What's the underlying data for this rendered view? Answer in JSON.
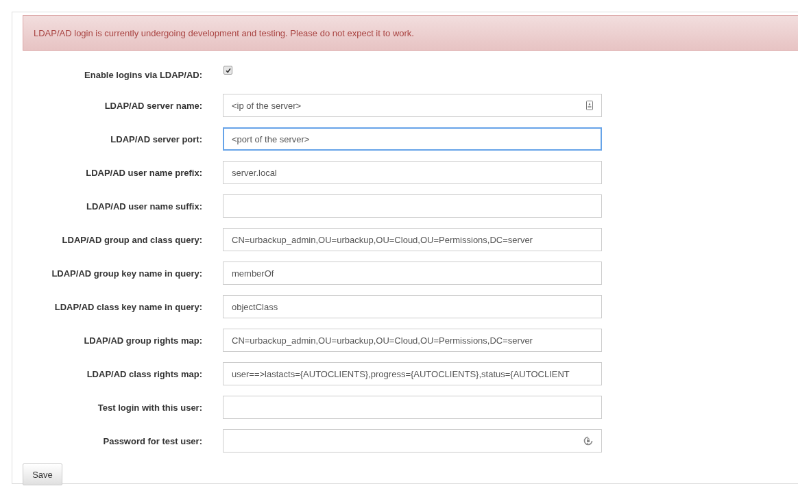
{
  "alert": {
    "text": "LDAP/AD login is currently undergoing development and testing. Please do not expect it to work."
  },
  "fields": [
    {
      "kind": "checkbox",
      "label": "Enable logins via LDAP/AD:",
      "checked": true
    },
    {
      "kind": "autofill",
      "label": "LDAP/AD server name:",
      "value": "<ip of the server>",
      "focused": false
    },
    {
      "kind": "text",
      "label": "LDAP/AD server port:",
      "value": "<port of the server>",
      "focused": true
    },
    {
      "kind": "text",
      "label": "LDAP/AD user name prefix:",
      "value": "server.local",
      "focused": false
    },
    {
      "kind": "text",
      "label": "LDAP/AD user name suffix:",
      "focused": false
    },
    {
      "kind": "text",
      "label": "LDAP/AD group and class query:",
      "value": "CN=urbackup_admin,OU=urbackup,OU=Cloud,OU=Permissions,DC=server",
      "focused": false
    },
    {
      "kind": "text",
      "label": "LDAP/AD group key name in query:",
      "value": "memberOf",
      "focused": false
    },
    {
      "kind": "text",
      "label": "LDAP/AD class key name in query:",
      "value": "objectClass",
      "focused": false
    },
    {
      "kind": "text",
      "label": "LDAP/AD group rights map:",
      "value": "CN=urbackup_admin,OU=urbackup,OU=Cloud,OU=Permissions,DC=server",
      "focused": false
    },
    {
      "kind": "text",
      "label": "LDAP/AD class rights map:",
      "value": "user==>lastacts={AUTOCLIENTS},progress={AUTOCLIENTS},status={AUTOCLIENT",
      "focused": false
    },
    {
      "kind": "text",
      "label": "Test login with this user:",
      "focused": false
    },
    {
      "kind": "password",
      "label": "Password for test user:",
      "focused": false
    }
  ],
  "save_button": {
    "label": "Save"
  }
}
